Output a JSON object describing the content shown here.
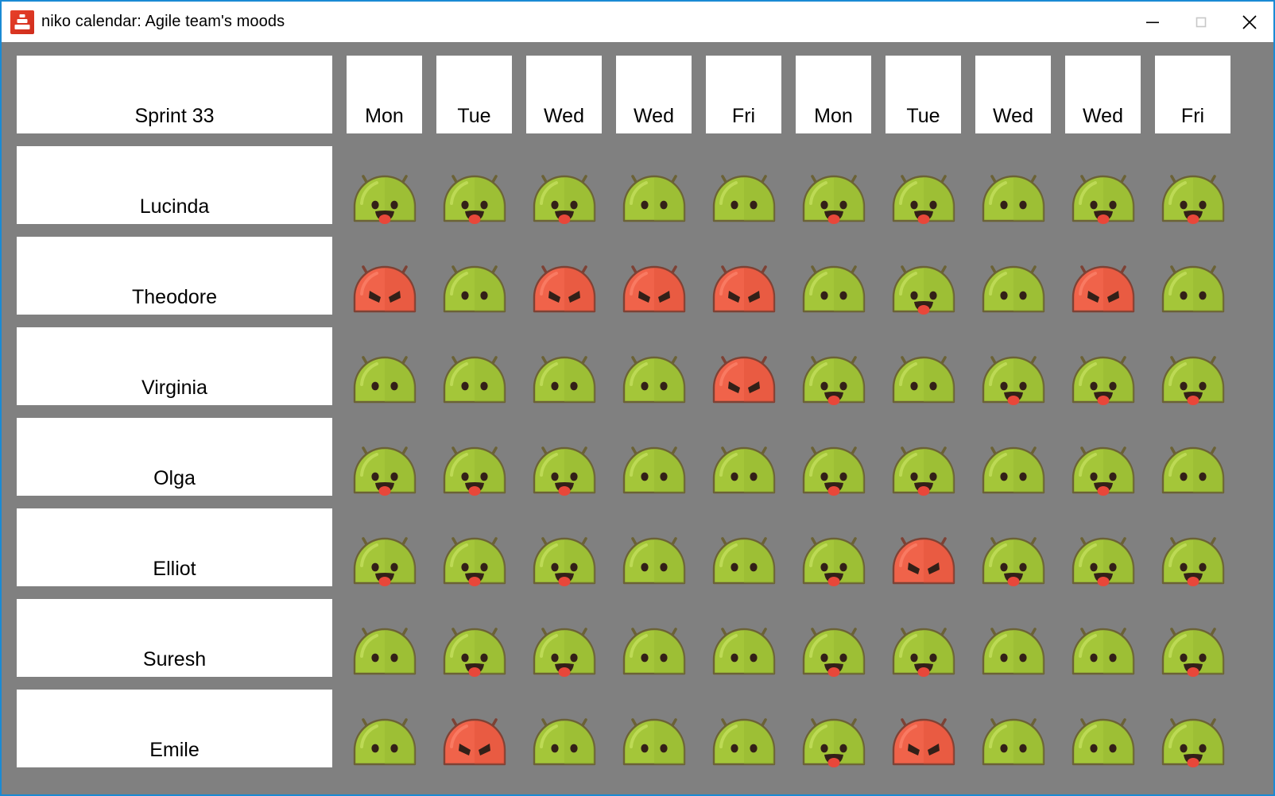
{
  "window": {
    "title": "niko calendar: Agile team's moods",
    "app_icon": "stacked-bars-icon",
    "accent_color": "#1a8ad4",
    "background_color": "#808080",
    "controls": {
      "minimize": "minimize-icon",
      "maximize": "maximize-icon",
      "close": "close-icon"
    }
  },
  "board": {
    "sprint_label": "Sprint 33",
    "days": [
      "Mon",
      "Tue",
      "Wed",
      "Wed",
      "Fri",
      "Mon",
      "Tue",
      "Wed",
      "Wed",
      "Fri"
    ],
    "mood_colors": {
      "happy": "#a4c639",
      "neutral": "#a4c639",
      "angry": "#f0634a"
    },
    "mood_legend": {
      "happy": "green smiling android face with open mouth and red tongue",
      "neutral": "green android face with eyes only",
      "angry": "red android face with angry slanted eyes"
    },
    "rows": [
      {
        "name": "Lucinda",
        "moods": [
          "happy",
          "happy",
          "happy",
          "neutral",
          "neutral",
          "happy",
          "happy",
          "neutral",
          "happy",
          "happy"
        ]
      },
      {
        "name": "Theodore",
        "moods": [
          "angry",
          "neutral",
          "angry",
          "angry",
          "angry",
          "neutral",
          "happy",
          "neutral",
          "angry",
          "neutral"
        ]
      },
      {
        "name": "Virginia",
        "moods": [
          "neutral",
          "neutral",
          "neutral",
          "neutral",
          "angry",
          "happy",
          "neutral",
          "happy",
          "happy",
          "happy"
        ]
      },
      {
        "name": "Olga",
        "moods": [
          "happy",
          "happy",
          "happy",
          "neutral",
          "neutral",
          "happy",
          "happy",
          "neutral",
          "happy",
          "neutral"
        ]
      },
      {
        "name": "Elliot",
        "moods": [
          "happy",
          "happy",
          "happy",
          "neutral",
          "neutral",
          "happy",
          "angry",
          "happy",
          "happy",
          "happy"
        ]
      },
      {
        "name": "Suresh",
        "moods": [
          "neutral",
          "happy",
          "happy",
          "neutral",
          "neutral",
          "happy",
          "happy",
          "neutral",
          "neutral",
          "happy"
        ]
      },
      {
        "name": "Emile",
        "moods": [
          "neutral",
          "angry",
          "neutral",
          "neutral",
          "neutral",
          "happy",
          "angry",
          "neutral",
          "neutral",
          "happy"
        ]
      }
    ]
  }
}
